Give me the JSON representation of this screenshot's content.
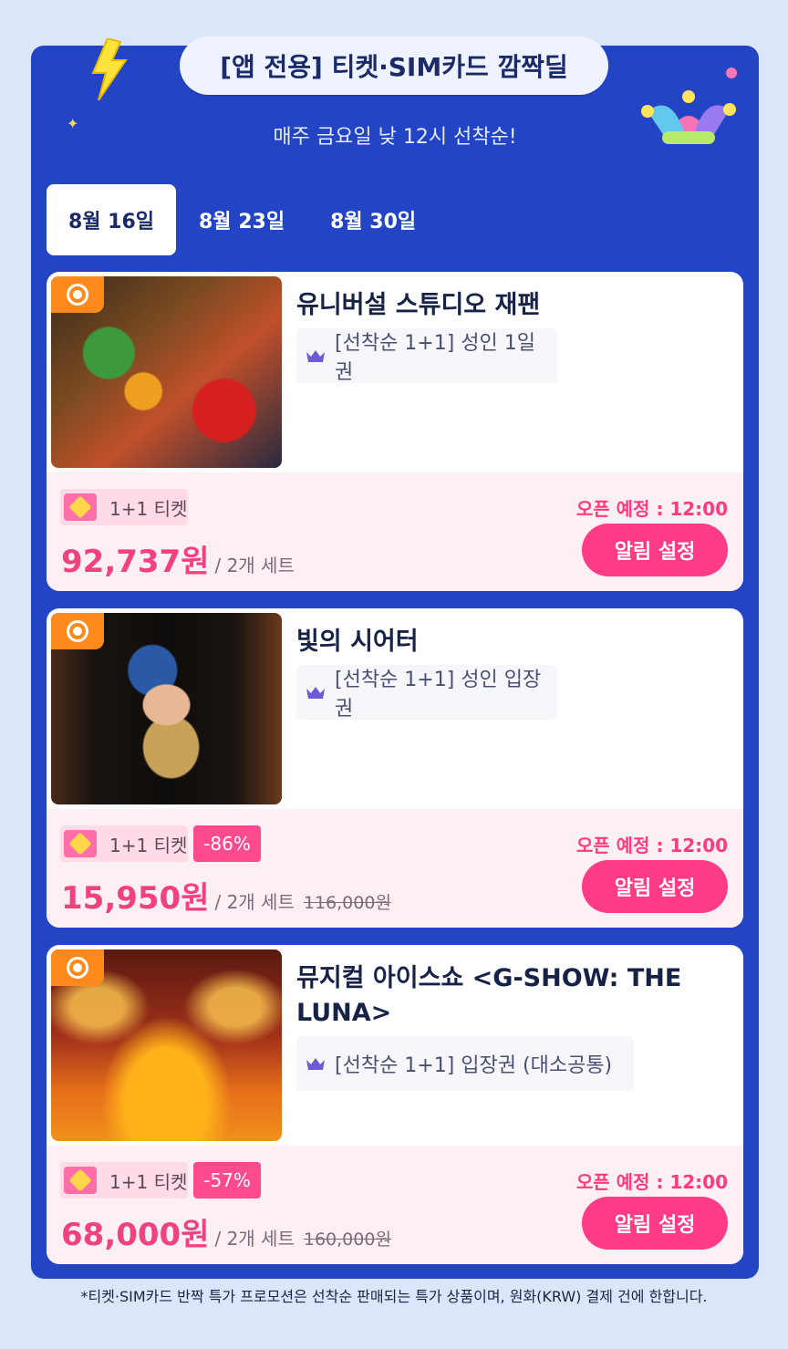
{
  "header": {
    "title": "[앱 전용] 티켓·SIM카드 깜짝딜",
    "subtitle": "매주 금요일 낮 12시 선착순!"
  },
  "tabs": [
    {
      "label": "8월 16일",
      "active": true
    },
    {
      "label": "8월 23일",
      "active": false
    },
    {
      "label": "8월 30일",
      "active": false
    }
  ],
  "products": [
    {
      "title": "유니버설 스튜디오 재팬",
      "option": "[선착순 1+1] 성인 1일권",
      "tag": "1+1 티켓",
      "discount": "",
      "price": "92,737원",
      "unit": "/ 2개 세트",
      "original_price": "",
      "open_time": "오픈 예정 : 12:00",
      "button": "알림 설정"
    },
    {
      "title": "빛의 시어터",
      "option": "[선착순 1+1] 성인 입장권",
      "tag": "1+1 티켓",
      "discount": "-86%",
      "price": "15,950원",
      "unit": "/ 2개 세트",
      "original_price": "116,000원",
      "open_time": "오픈 예정 : 12:00",
      "button": "알림 설정"
    },
    {
      "title": "뮤지컬 아이스쇼 <G-SHOW: THE LUNA>",
      "option": "[선착순 1+1] 입장권 (대소공통)",
      "tag": "1+1 티켓",
      "discount": "-57%",
      "price": "68,000원",
      "unit": "/ 2개 세트",
      "original_price": "160,000원",
      "open_time": "오픈 예정 : 12:00",
      "button": "알림 설정"
    }
  ],
  "footnote": "*티켓·SIM카드 반짝 특가 프로모션은 선착순 판매되는 특가 상품이며, 원화(KRW) 결제 건에 한합니다.",
  "colors": {
    "panel": "#2344c4",
    "accent_pink": "#ff3b86",
    "price_pink": "#f0427f",
    "badge_orange": "#ff8a1c"
  },
  "icons": {
    "header_left": "lightning-bolt-icon",
    "header_right": "jester-hat-icon",
    "option": "crown-icon",
    "tag": "ticket-icon",
    "thumb_badge": "flower-badge-icon"
  }
}
